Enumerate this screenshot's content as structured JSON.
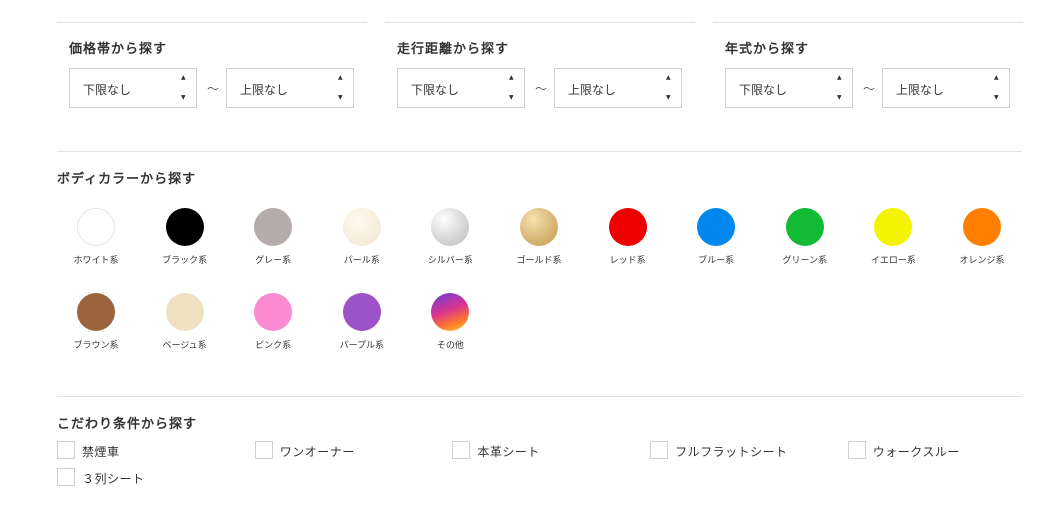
{
  "range_filters": [
    {
      "title": "価格帯から探す",
      "min_value": "下限なし",
      "max_value": "上限なし",
      "separator": "～"
    },
    {
      "title": "走行距離から探す",
      "min_value": "下限なし",
      "max_value": "上限なし",
      "separator": "～"
    },
    {
      "title": "年式から探す",
      "min_value": "下限なし",
      "max_value": "上限なし",
      "separator": "～"
    }
  ],
  "select_arrows": {
    "up": "▲",
    "down": "▼"
  },
  "body_color": {
    "title": "ボディカラーから探す",
    "swatches": [
      {
        "label": "ホワイト系",
        "color": "#ffffff"
      },
      {
        "label": "ブラック系",
        "color": "#000000"
      },
      {
        "label": "グレー系",
        "color": "#b3acab"
      },
      {
        "label": "パール系",
        "color": "#f4ecd6"
      },
      {
        "label": "シルバー系",
        "color": "#d6d6d6"
      },
      {
        "label": "ゴールド系",
        "color": "#d7b775"
      },
      {
        "label": "レッド系",
        "color": "#ee0000"
      },
      {
        "label": "ブルー系",
        "color": "#0088ee"
      },
      {
        "label": "グリーン系",
        "color": "#11bb33"
      },
      {
        "label": "イエロー系",
        "color": "#f4f400"
      },
      {
        "label": "オレンジ系",
        "color": "#ff8000"
      },
      {
        "label": "ブラウン系",
        "color": "#9b643e"
      },
      {
        "label": "ベージュ系",
        "color": "#f0e2c0"
      },
      {
        "label": "ピンク系",
        "color": "#fb8bd0"
      },
      {
        "label": "パープル系",
        "color": "#9c52c8"
      },
      {
        "label": "その他",
        "color": "gradient"
      }
    ]
  },
  "preferences": {
    "title": "こだわり条件から探す",
    "options": [
      {
        "label": "禁煙車",
        "checked": false
      },
      {
        "label": "ワンオーナー",
        "checked": false
      },
      {
        "label": "本革シート",
        "checked": false
      },
      {
        "label": "フルフラットシート",
        "checked": false
      },
      {
        "label": "ウォークスルー",
        "checked": false
      },
      {
        "label": "３列シート",
        "checked": false
      }
    ]
  }
}
